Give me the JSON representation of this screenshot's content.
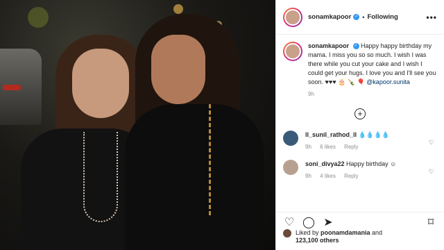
{
  "header": {
    "username": "sonamkapoor",
    "separator": "•",
    "follow_label": "Following",
    "more_label": "•••"
  },
  "caption": {
    "username": "sonamkapoor",
    "text": "Happy happy birthday my mama. I miss you so so much. I wish I was there while you cut your cake and I wish I could get your hugs. I love you and I'll see you soon. ♥♥♥ 🎂 🍾 🎈 ",
    "mention": "@kapoor.sunita",
    "time": "9h"
  },
  "load_more_label": "+",
  "comments": [
    {
      "username": "ll_sunil_rathod_ll",
      "text": "💧💧💧💧",
      "time": "9h",
      "likes": "6 likes",
      "reply": "Reply"
    },
    {
      "username": "soni_divya22",
      "text": "Happy birthday ☺",
      "time": "9h",
      "likes": "4 likes",
      "reply": "Reply"
    }
  ],
  "actions": {
    "like_icon": "♡",
    "comment_icon": "◯",
    "share_icon": "➤",
    "save_icon": "⌑"
  },
  "likes": {
    "prefix": "Liked by ",
    "user": "poonamdamania",
    "and": " and",
    "count_line": "123,100 others"
  },
  "colors": {
    "link": "#003569",
    "verified": "#3897f0",
    "muted": "#8e8e8e"
  }
}
